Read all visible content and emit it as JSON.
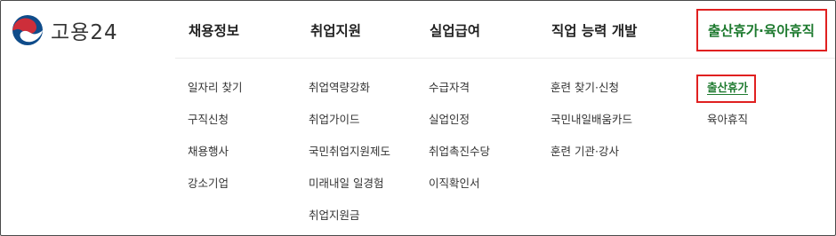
{
  "logo": {
    "text": "고용24"
  },
  "colors": {
    "accent_green": "#1e7a2f",
    "highlight_red": "#e02020",
    "logo_red": "#cd2e3a",
    "logo_blue": "#0f4c8a"
  },
  "nav": [
    {
      "label": "채용정보",
      "items": [
        "일자리 찾기",
        "구직신청",
        "채용행사",
        "강소기업"
      ]
    },
    {
      "label": "취업지원",
      "items": [
        "취업역량강화",
        "취업가이드",
        "국민취업지원제도",
        "미래내일 일경험",
        "취업지원금"
      ]
    },
    {
      "label": "실업급여",
      "items": [
        "수급자격",
        "실업인정",
        "취업촉진수당",
        "이직확인서"
      ]
    },
    {
      "label": "직업 능력 개발",
      "items": [
        "훈련 찾기·신청",
        "국민내일배움카드",
        "훈련 기관·강사"
      ]
    },
    {
      "label": "출산휴가·육아휴직",
      "active": true,
      "items": [
        "출산휴가",
        "육아휴직"
      ],
      "active_item": "출산휴가"
    }
  ]
}
